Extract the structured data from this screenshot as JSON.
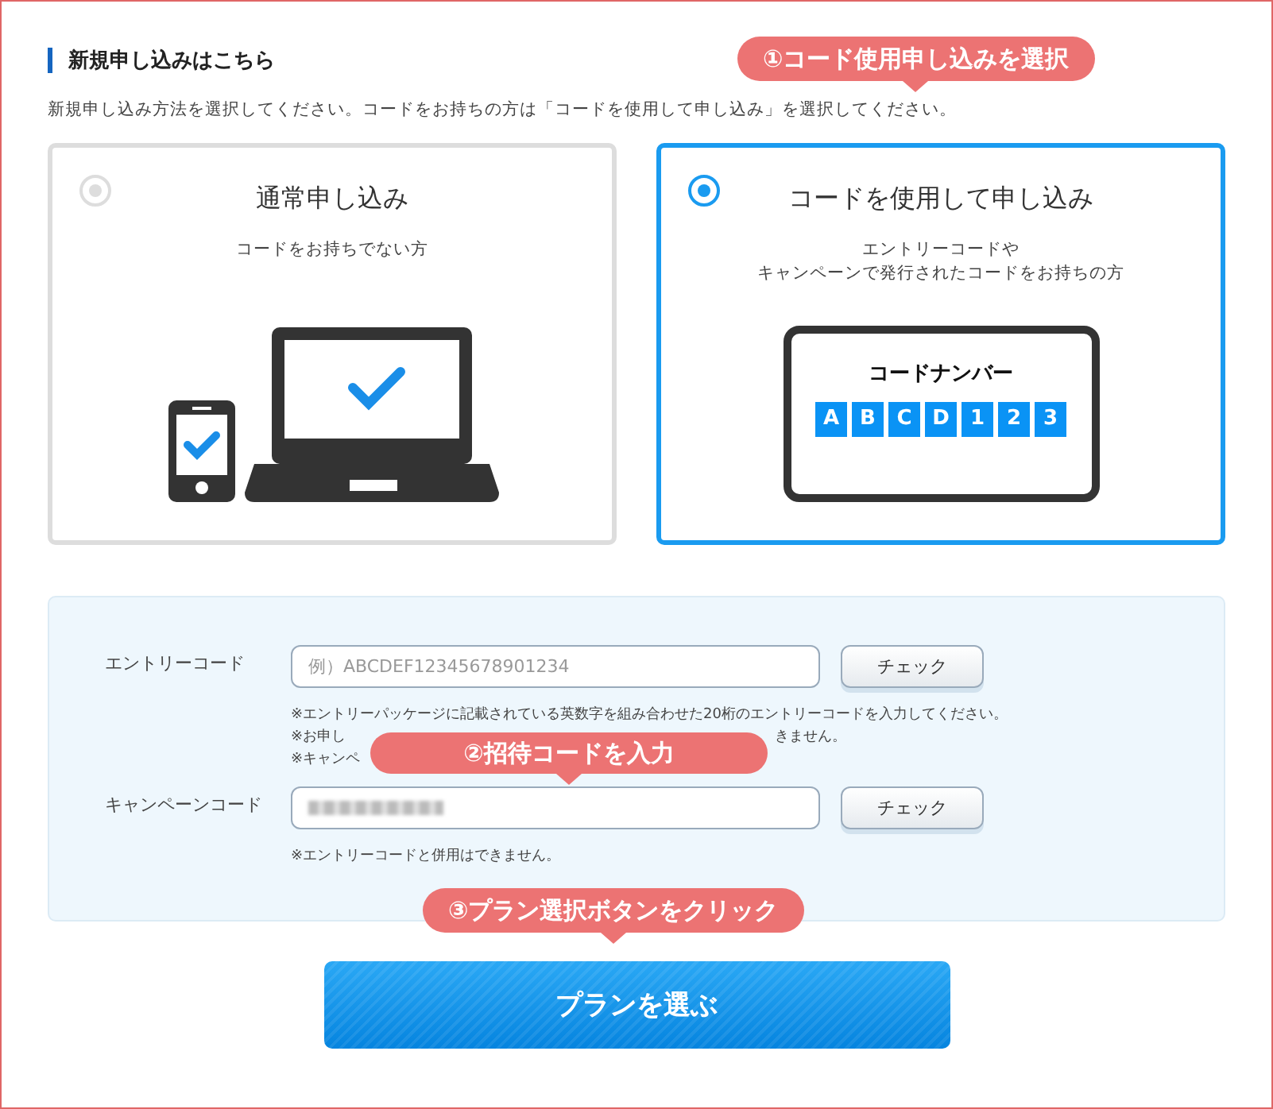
{
  "section": {
    "title": "新規申し込みはこちら",
    "description": "新規申し込み方法を選択してください。コードをお持ちの方は「コードを使用して申し込み」を選択してください。"
  },
  "options": [
    {
      "kind": "devices",
      "title": "通常申し込み",
      "subtitle": [
        "コードをお持ちでない方"
      ],
      "selected": false
    },
    {
      "kind": "code",
      "title": "コードを使用して申し込み",
      "subtitle": [
        "エントリーコードや",
        "キャンペーンで発行されたコードをお持ちの方"
      ],
      "selected": true,
      "card_title": "コードナンバー",
      "code_chars": [
        "A",
        "B",
        "C",
        "D",
        "1",
        "2",
        "3"
      ]
    }
  ],
  "form": {
    "rows": [
      {
        "label": "エントリーコード",
        "placeholder": "例）ABCDEF12345678901234",
        "button": "チェック",
        "notes": [
          [
            "※エントリーパッケージに記載されている英数字を組み合わせた20桁のエントリーコードを入力してください。"
          ],
          [
            "※お申し",
            "きません。"
          ],
          [
            "※キャンペ"
          ]
        ]
      },
      {
        "label": "キャンペーンコード",
        "value_redacted": true,
        "button": "チェック",
        "notes": [
          [
            "※エントリーコードと併用はできません。"
          ]
        ]
      }
    ]
  },
  "submit": "プランを選ぶ",
  "callouts": [
    {
      "text": "①コード使用申し込みを選択"
    },
    {
      "text": "②招待コードを入力"
    },
    {
      "text": "③プラン選択ボタンをクリック"
    }
  ]
}
